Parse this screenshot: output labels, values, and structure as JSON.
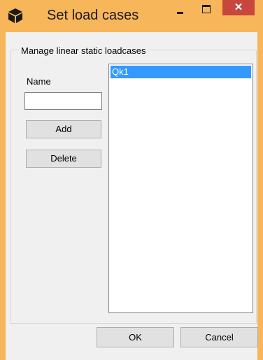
{
  "window": {
    "title": "Set load cases",
    "close_glyph": "✕"
  },
  "group": {
    "label": "Manage linear static loadcases"
  },
  "form": {
    "name_label": "Name",
    "name_value": "",
    "add_label": "Add",
    "delete_label": "Delete"
  },
  "loadcases": {
    "items": [
      "Qk1"
    ],
    "selected_index": 0
  },
  "footer": {
    "ok_label": "OK",
    "cancel_label": "Cancel"
  },
  "icons": {
    "app": "cube-icon",
    "minimize": "minimize-icon",
    "maximize": "maximize-icon",
    "close": "close-icon"
  },
  "colors": {
    "titlebar": "#f8b65b",
    "close": "#c7463d",
    "selection": "#3399ff",
    "client": "#f0f0f0"
  }
}
